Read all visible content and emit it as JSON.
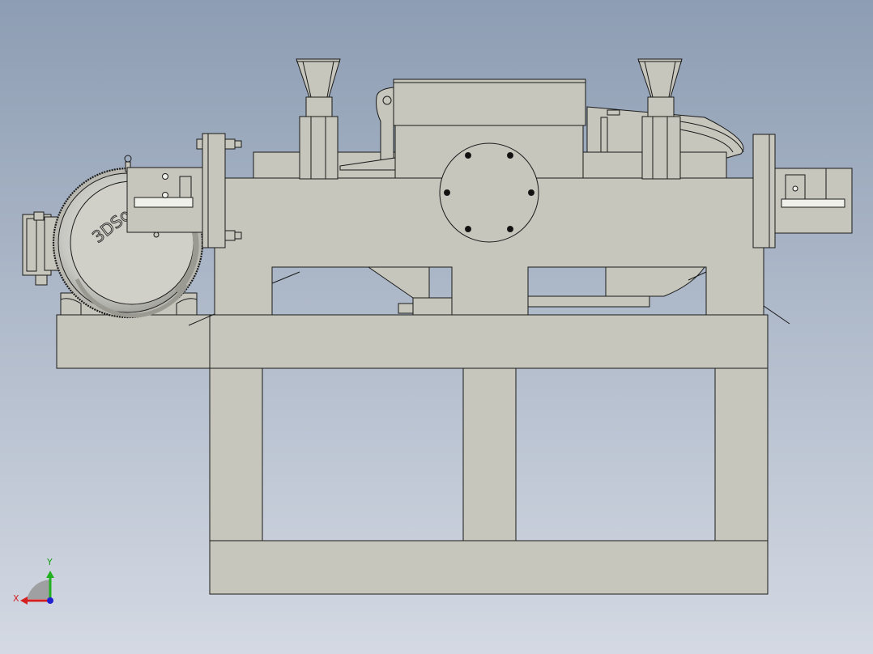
{
  "viewport": {
    "background_top": "#8d9db3",
    "background_bottom": "#d4d9e3",
    "part_fill": "#c6c6bc",
    "part_shadow": "#a9a99f",
    "edge_color": "#1a1a1a",
    "bolt_color": "#111111"
  },
  "model": {
    "watermark_text": "3DSo"
  },
  "triad": {
    "x_label": "X",
    "y_label": "Y",
    "x_color": "#d42020",
    "y_color": "#20b020",
    "z_color": "#2020d0"
  }
}
